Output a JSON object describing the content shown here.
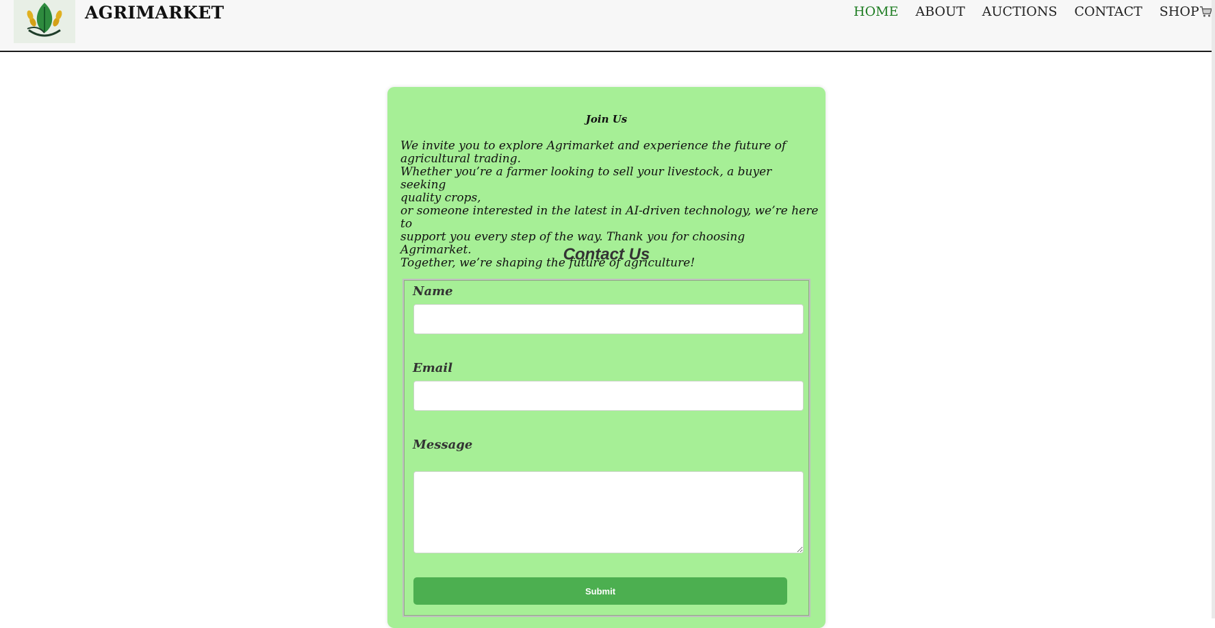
{
  "header": {
    "brand": "AGRIMARKET",
    "nav": [
      {
        "label": "HOME",
        "active": true
      },
      {
        "label": "ABOUT",
        "active": false
      },
      {
        "label": "AUCTIONS",
        "active": false
      },
      {
        "label": "CONTACT",
        "active": false
      },
      {
        "label": "SHOP",
        "active": false
      }
    ],
    "active_color": "#1f7d23"
  },
  "join": {
    "title": "Join Us",
    "lines": [
      "We invite you to explore Agrimarket and experience the future of",
      "agricultural trading.",
      "Whether you’re a farmer looking to sell your livestock, a buyer seeking",
      "quality crops,",
      "or someone interested in the latest in AI-driven technology, we’re here to",
      "support you every step of the way. Thank you for choosing Agrimarket.",
      "Together, we’re shaping the future of agriculture!"
    ]
  },
  "contact": {
    "title": "Contact Us",
    "name_label": "Name",
    "name_value": "",
    "email_label": "Email",
    "email_value": "",
    "message_label": "Message",
    "message_value": "",
    "submit_label": "Submit"
  },
  "colors": {
    "card_bg": "#a6ef96",
    "button_bg": "#4caf50"
  },
  "icons": [
    "logo-wheat-leaf",
    "cart-icon"
  ]
}
